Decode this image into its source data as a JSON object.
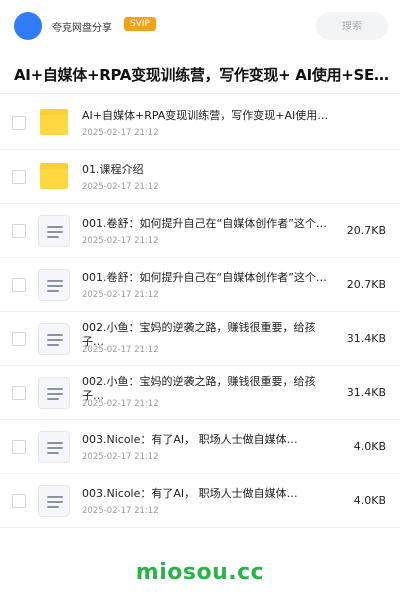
{
  "header": {
    "user_name": "夸克网盘分享",
    "badge": "SVIP",
    "search_placeholder": "搜索",
    "avatar_color": "#2f7cf6"
  },
  "folder_title": "AI+自媒体+RPA变现训练营，写作变现+ AI使用+SEO+…",
  "files": [
    {
      "type": "folder",
      "name": "AI+自媒体+RPA变现训练营，写作变现+AI使用…",
      "date": "2025-02-17 21:12",
      "size": ""
    },
    {
      "type": "folder",
      "name": "01.课程介绍",
      "date": "2025-02-17 21:12",
      "size": ""
    },
    {
      "type": "doc",
      "name": "001.卷舒：如何提升自己在“自媒体创作者”这个岗…",
      "date": "2025-02-17 21:12",
      "size": "20.7KB"
    },
    {
      "type": "doc",
      "name": "001.卷舒：如何提升自己在“自媒体创作者”这个岗…",
      "date": "2025-02-17 21:12",
      "size": "20.7KB"
    },
    {
      "type": "doc",
      "name": "002.小鱼：宝妈的逆袭之路，赚钱很重要，给孩子…",
      "date": "2025-02-17 21:12",
      "size": "31.4KB"
    },
    {
      "type": "doc",
      "name": "002.小鱼：宝妈的逆袭之路，赚钱很重要，给孩子…",
      "date": "2025-02-17 21:12",
      "size": "31.4KB"
    },
    {
      "type": "doc",
      "name": "003.Nicole：有了AI， 职场人士做自媒体…",
      "date": "2025-02-17 21:12",
      "size": "4.0KB"
    },
    {
      "type": "doc",
      "name": "003.Nicole：有了AI， 职场人士做自媒体…",
      "date": "2025-02-17 21:12",
      "size": "4.0KB"
    }
  ],
  "watermark": "miosou.cc",
  "colors": {
    "accent": "#2f7cf6",
    "svip": "#f5a21b",
    "watermark": "#2bb24c",
    "folder": "#ffd83f"
  }
}
